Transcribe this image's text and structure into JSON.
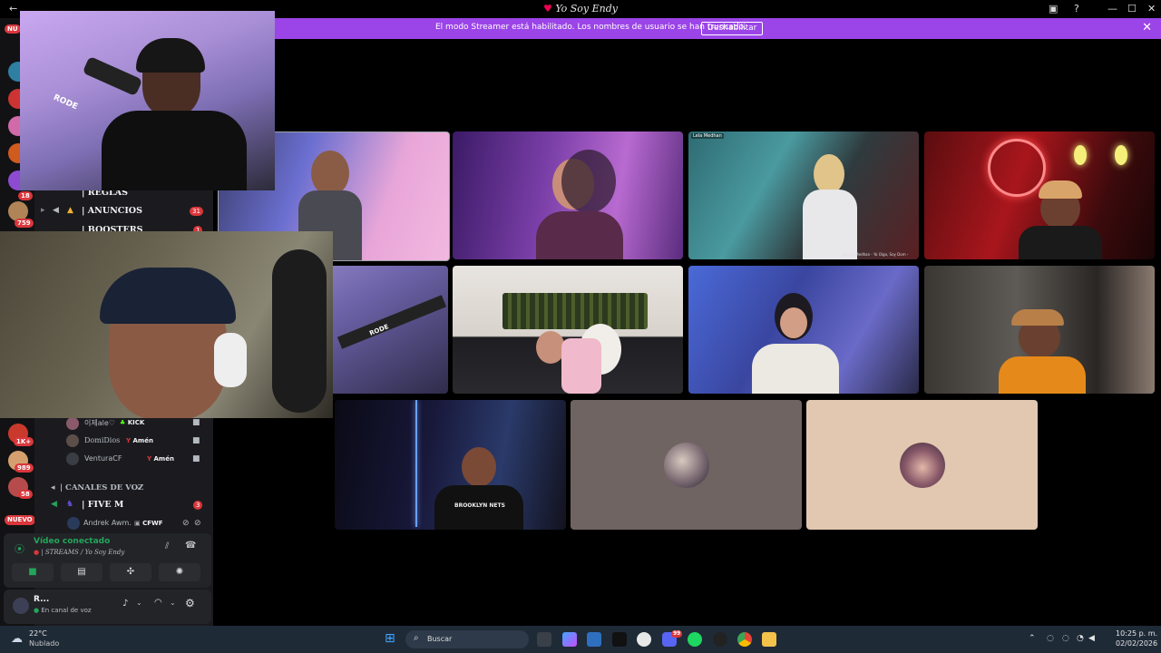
{
  "window": {
    "title": "Yo Soy Endy"
  },
  "banner": {
    "text": "El modo Streamer está habilitado. Los nombres de usuario se han truncado.",
    "button": "Deshabilitar",
    "close": "✕"
  },
  "servers": {
    "top_badge": "NU",
    "badges": [
      "18",
      "759",
      "1K+",
      "989",
      "58"
    ],
    "new_badge": "NUEVO"
  },
  "channels": {
    "items": [
      {
        "label": "| REGLAS"
      },
      {
        "label": "| ANUNCIOS",
        "badge": "31"
      },
      {
        "label": "| BOOSTERS",
        "badge": "1"
      }
    ],
    "voice_users": [
      {
        "name": "이제ale♡",
        "tag": "KICK"
      },
      {
        "name": "DomiDios",
        "tag": "Amén"
      },
      {
        "name": "VenturaCF",
        "tag": "Amén"
      }
    ],
    "voice_category": "| CANALES DE VOZ",
    "voice_channel": {
      "label": "| FIVE M",
      "badge": "3"
    },
    "voice_channel_user": {
      "name": "Andrek Awm.",
      "tag": "CFWF"
    }
  },
  "voice_panel": {
    "status": "Vídeo conectado",
    "channel": "| STREAMS / Yo Soy Endy"
  },
  "user_panel": {
    "name": "R...",
    "status": "En canal de voz"
  },
  "tiles": {
    "t3_label": "Lela Medhan",
    "t3_caption": "@Lela_Medhan - Yo Oigo, Soy Dom -"
  },
  "overlays": {
    "mic_brand_1": "RODE",
    "mic_brand_2": "RODE",
    "jersey": "BROOKLYN NETS"
  },
  "taskbar": {
    "weather_temp": "22°C",
    "weather_desc": "Nublado",
    "search": "Buscar",
    "time": "10:25 p. m.",
    "date": "02/02/2026",
    "discord_badge": "99"
  },
  "colors": {
    "accent": "#9b44e8",
    "danger": "#da373c",
    "connected": "#23a55a"
  }
}
